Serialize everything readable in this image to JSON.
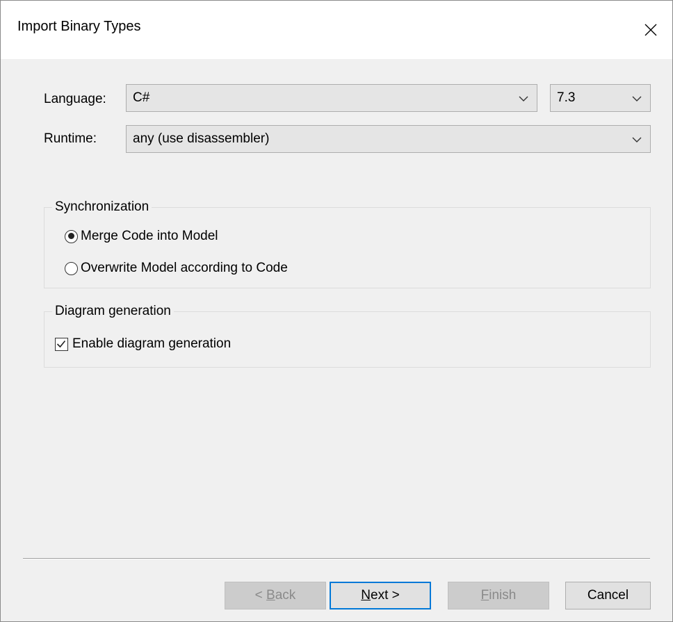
{
  "dialog": {
    "title": "Import Binary Types"
  },
  "form": {
    "language_label": "Language:",
    "language_value": "C#",
    "version_value": "7.3",
    "runtime_label": "Runtime:",
    "runtime_value": "any (use disassembler)"
  },
  "synchronization": {
    "title": "Synchronization",
    "options": [
      {
        "label": "Merge Code into Model",
        "selected": true
      },
      {
        "label": "Overwrite Model according to Code",
        "selected": false
      }
    ]
  },
  "diagram": {
    "title": "Diagram generation",
    "checkbox_label": "Enable diagram generation",
    "checked": true
  },
  "buttons": {
    "back_prefix": "< ",
    "back_mnemonic": "B",
    "back_rest": "ack",
    "next_mnemonic": "N",
    "next_rest": "ext >",
    "finish_mnemonic": "F",
    "finish_rest": "inish",
    "cancel": "Cancel"
  },
  "icons": {
    "close": "close-icon",
    "dropdown": "chevron-down-icon",
    "check": "checkmark-icon"
  },
  "colors": {
    "default_button_border": "#0078d7",
    "dialog_background": "#f0f0f0",
    "disabled_button": "#cccccc"
  }
}
